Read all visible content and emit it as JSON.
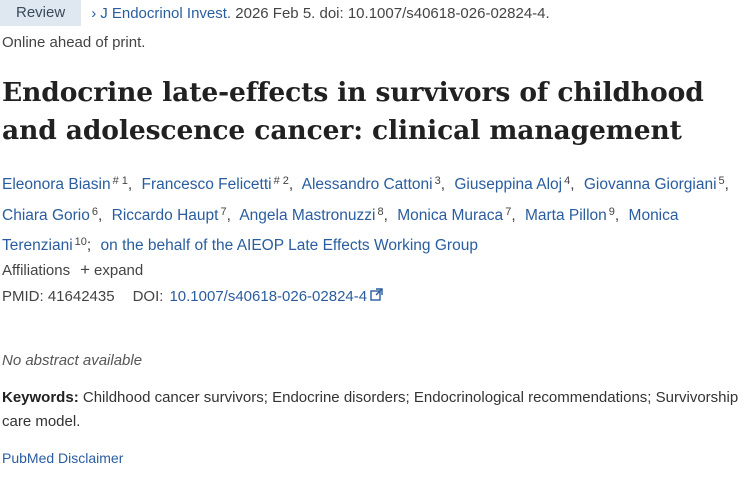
{
  "article_type": "Review",
  "citation": {
    "journal": "J Endocrinol Invest.",
    "details": " 2026 Feb 5. doi: 10.1007/s40618-026-02824-4."
  },
  "publication_status": "Online ahead of print.",
  "title": "Endocrine late-effects in survivors of childhood and adolescence cancer: clinical management",
  "authors": [
    {
      "name": "Eleonora Biasin",
      "sup": "# 1"
    },
    {
      "name": "Francesco Felicetti",
      "sup": "# 2"
    },
    {
      "name": "Alessandro Cattoni",
      "sup": "3"
    },
    {
      "name": "Giuseppina Aloj",
      "sup": "4"
    },
    {
      "name": "Giovanna Giorgiani",
      "sup": "5"
    },
    {
      "name": "Chiara Gorio",
      "sup": "6"
    },
    {
      "name": "Riccardo Haupt",
      "sup": "7"
    },
    {
      "name": "Angela Mastronuzzi",
      "sup": "8"
    },
    {
      "name": "Monica Muraca",
      "sup": "7"
    },
    {
      "name": "Marta Pillon",
      "sup": "9"
    },
    {
      "name": "Monica Terenziani",
      "sup": "10"
    }
  ],
  "collective_author": "on the behalf of the AIEOP Late Effects Working Group",
  "affiliations": {
    "label": "Affiliations",
    "expand_label": "expand"
  },
  "identifiers": {
    "pmid_label": "PMID:",
    "pmid": "41642435",
    "doi_label": "DOI:",
    "doi": "10.1007/s40618-026-02824-4"
  },
  "abstract_status": "No abstract available",
  "keywords": {
    "label": "Keywords:",
    "text": " Childhood cancer survivors; Endocrine disorders; Endocrinological recommendations; Survivorship care model."
  },
  "disclaimer_link": "PubMed Disclaimer",
  "colors": {
    "link": "#2a5d9f",
    "badge_bg": "#dfe7f0",
    "text": "#212121"
  },
  "icons": {
    "external_link": "external-link-icon",
    "expand": "plus-icon",
    "breadcrumb": "chevron-right-icon"
  }
}
